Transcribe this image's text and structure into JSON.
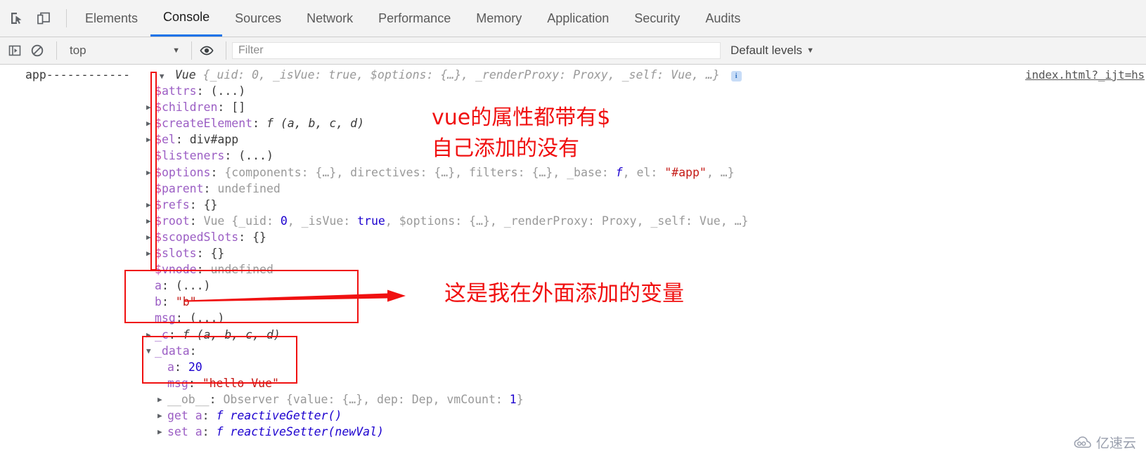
{
  "toolbar": {
    "inspect_icon": "inspect-cursor-icon",
    "device_icon": "device-toolbar-icon",
    "tabs": [
      {
        "label": "Elements",
        "active": false
      },
      {
        "label": "Console",
        "active": true
      },
      {
        "label": "Sources",
        "active": false
      },
      {
        "label": "Network",
        "active": false
      },
      {
        "label": "Performance",
        "active": false
      },
      {
        "label": "Memory",
        "active": false
      },
      {
        "label": "Application",
        "active": false
      },
      {
        "label": "Security",
        "active": false
      },
      {
        "label": "Audits",
        "active": false
      }
    ]
  },
  "filterbar": {
    "sidebar_icon": "console-sidebar-icon",
    "clear_icon": "clear-console-icon",
    "context": "top",
    "eye_icon": "live-expression-eye-icon",
    "filter_placeholder": "Filter",
    "filter_value": "",
    "levels_label": "Default levels",
    "levels_caret": "▾"
  },
  "console": {
    "source_link": "index.html?_ijt=hs",
    "label": "app------------",
    "header": {
      "ctor": "Vue",
      "preview": " {_uid: 0, _isVue: true, $options: {…}, _renderProxy: Proxy, _self: Vue, …}",
      "badge": "i"
    },
    "rows": [
      {
        "arrow": false,
        "key": "$attrs",
        "sep": ": ",
        "value": "(...)",
        "vclass": "k-plain"
      },
      {
        "arrow": true,
        "key": "$children",
        "sep": ": ",
        "value": "[]",
        "vclass": "k-plain"
      },
      {
        "arrow": true,
        "key": "$createElement",
        "sep": ": ",
        "value": "f (a, b, c, d)",
        "vclass": "k-italic"
      },
      {
        "arrow": true,
        "key": "$el",
        "sep": ": ",
        "value": "div#app",
        "vclass": "k-plain"
      },
      {
        "arrow": false,
        "key": "$listeners",
        "sep": ": ",
        "value": "(...)",
        "vclass": "k-plain"
      },
      {
        "arrow": true,
        "key": "$options",
        "sep": ": ",
        "value": "{components: {…}, directives: {…}, filters: {…}, _base: f, el: \"#app\", …}",
        "vclass": "k-opts"
      },
      {
        "arrow": false,
        "key": "$parent",
        "sep": ": ",
        "value": "undefined",
        "vclass": "k-dim"
      },
      {
        "arrow": true,
        "key": "$refs",
        "sep": ": ",
        "value": "{}",
        "vclass": "k-plain"
      },
      {
        "arrow": true,
        "key": "$root",
        "sep": ": ",
        "value": "Vue {_uid: 0, _isVue: true, $options: {…}, _renderProxy: Proxy, _self: Vue, …}",
        "vclass": "k-root"
      },
      {
        "arrow": true,
        "key": "$scopedSlots",
        "sep": ": ",
        "value": "{}",
        "vclass": "k-plain"
      },
      {
        "arrow": true,
        "key": "$slots",
        "sep": ": ",
        "value": "{}",
        "vclass": "k-plain"
      },
      {
        "arrow": false,
        "key": "$vnode",
        "sep": ": ",
        "value": "undefined",
        "vclass": "k-dim"
      }
    ],
    "own_rows": [
      {
        "key": "a",
        "sep": ": ",
        "value": "(...)",
        "vclass": "k-plain"
      },
      {
        "key": "b",
        "sep": ": ",
        "value": "\"b\"",
        "vclass": "k-val-str"
      },
      {
        "key": "msg",
        "sep": ": ",
        "value": "(...)",
        "vclass": "k-plain"
      }
    ],
    "c_row": {
      "arrow": true,
      "key": "_c",
      "sep": ": ",
      "value": "f (a, b, c, d)"
    },
    "data_row": {
      "arrow_open": true,
      "key": "_data",
      "sep": ":"
    },
    "data_children": [
      {
        "key": "a",
        "sep": ": ",
        "value": "20",
        "vclass": "k-val-num"
      },
      {
        "key": "msg",
        "sep": ": ",
        "value": "\"hello Vue\"",
        "vclass": "k-val-str"
      }
    ],
    "tail_rows": [
      {
        "arrow": true,
        "key": "__ob__",
        "sep": ": ",
        "value": "Observer {value: {…}, dep: Dep, vmCount: 1}",
        "kclass": "k-dim",
        "vclass": "k-obs"
      },
      {
        "arrow": true,
        "key": "get a",
        "sep": ": ",
        "value": "f reactiveGetter()",
        "kclass": "k-getset",
        "vclass": "k-fn"
      },
      {
        "arrow": true,
        "key": "set a",
        "sep": ": ",
        "value": "f reactiveSetter(newVal)",
        "kclass": "k-getset",
        "vclass": "k-fn"
      }
    ]
  },
  "annotations": {
    "note1_line1": "vue的属性都带有$",
    "note1_line2": "自己添加的没有",
    "note2": "这是我在外面添加的变量",
    "color": "#f01010"
  },
  "watermark": {
    "text": "亿速云",
    "icon": "cloud-icon"
  }
}
